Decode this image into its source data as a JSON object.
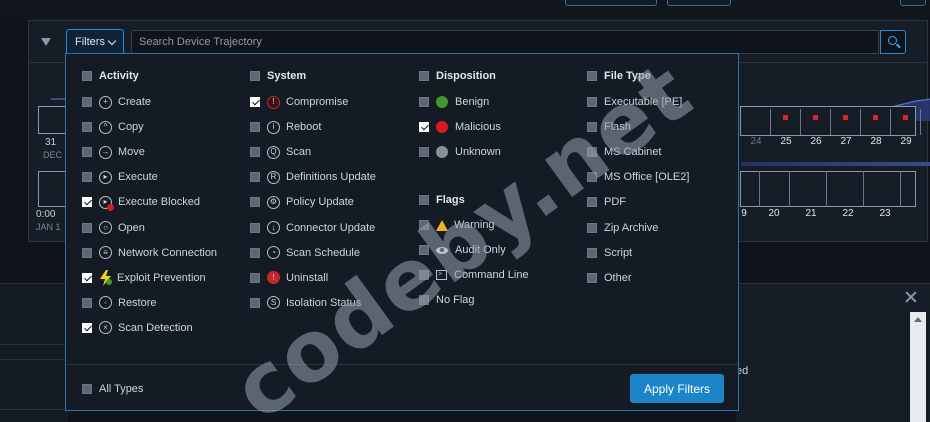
{
  "search": {
    "filters_label": "Filters",
    "placeholder": "Search Device Trajectory"
  },
  "timeline": {
    "left_dates": [
      {
        "day": "31",
        "sub": "DEC"
      },
      {
        "day": "0:00",
        "sub": "JAN 1"
      }
    ],
    "top_days": [
      {
        "n": "24",
        "dot": false,
        "dim": true
      },
      {
        "n": "25",
        "dot": true,
        "dim": false
      },
      {
        "n": "26",
        "dot": true,
        "dim": false
      },
      {
        "n": "27",
        "dot": true,
        "dim": false
      },
      {
        "n": "28",
        "dot": true,
        "dim": false
      },
      {
        "n": "29",
        "dot": true,
        "dim": false
      }
    ],
    "bottom_days": [
      "9",
      "20",
      "21",
      "22",
      "23"
    ]
  },
  "dropdown": {
    "activity": {
      "header": "Activity",
      "items": [
        {
          "label": "Create",
          "checked": false,
          "icon": "create-icon"
        },
        {
          "label": "Copy",
          "checked": false,
          "icon": "copy-icon"
        },
        {
          "label": "Move",
          "checked": false,
          "icon": "move-icon"
        },
        {
          "label": "Execute",
          "checked": false,
          "icon": "execute-icon"
        },
        {
          "label": "Execute Blocked",
          "checked": true,
          "icon": "execute-blocked-icon"
        },
        {
          "label": "Open",
          "checked": false,
          "icon": "open-icon"
        },
        {
          "label": "Network Connection",
          "checked": false,
          "icon": "network-connection-icon"
        },
        {
          "label": "Exploit Prevention",
          "checked": true,
          "icon": "exploit-prevention-icon"
        },
        {
          "label": "Restore",
          "checked": false,
          "icon": "restore-icon"
        },
        {
          "label": "Scan Detection",
          "checked": true,
          "icon": "scan-detection-icon"
        }
      ]
    },
    "system": {
      "header": "System",
      "items": [
        {
          "label": "Compromise",
          "checked": true,
          "icon": "compromise-icon"
        },
        {
          "label": "Reboot",
          "checked": false,
          "icon": "reboot-icon"
        },
        {
          "label": "Scan",
          "checked": false,
          "icon": "scan-icon"
        },
        {
          "label": "Definitions Update",
          "checked": false,
          "icon": "definitions-update-icon"
        },
        {
          "label": "Policy Update",
          "checked": false,
          "icon": "policy-update-icon"
        },
        {
          "label": "Connector Update",
          "checked": false,
          "icon": "connector-update-icon"
        },
        {
          "label": "Scan Schedule",
          "checked": false,
          "icon": "scan-schedule-icon"
        },
        {
          "label": "Uninstall",
          "checked": false,
          "icon": "uninstall-icon"
        },
        {
          "label": "Isolation Status",
          "checked": false,
          "icon": "isolation-status-icon"
        }
      ]
    },
    "disposition": {
      "header": "Disposition",
      "items": [
        {
          "label": "Benign",
          "checked": false,
          "color": "#3f9a2c"
        },
        {
          "label": "Malicious",
          "checked": true,
          "color": "#d21d23"
        },
        {
          "label": "Unknown",
          "checked": false,
          "color": "#8a9098"
        }
      ]
    },
    "flags": {
      "header": "Flags",
      "items": [
        {
          "label": "Warning",
          "checked": false,
          "icon": "warning-icon"
        },
        {
          "label": "Audit Only",
          "checked": false,
          "icon": "eye-icon"
        },
        {
          "label": "Command Line",
          "checked": false,
          "icon": "terminal-icon"
        },
        {
          "label": "No Flag",
          "checked": false,
          "icon": ""
        }
      ]
    },
    "file_type": {
      "header": "File Type",
      "items": [
        {
          "label": "Executable [PE]",
          "checked": false
        },
        {
          "label": "Flash",
          "checked": false
        },
        {
          "label": "MS Cabinet",
          "checked": false
        },
        {
          "label": "MS Office [OLE2]",
          "checked": false
        },
        {
          "label": "PDF",
          "checked": false
        },
        {
          "label": "Zip Archive",
          "checked": false
        },
        {
          "label": "Script",
          "checked": false
        },
        {
          "label": "Other",
          "checked": false
        }
      ]
    },
    "all_types_label": "All Types",
    "apply_label": "Apply Filters"
  },
  "side_fragment": "ed",
  "watermark": "codeby.net"
}
